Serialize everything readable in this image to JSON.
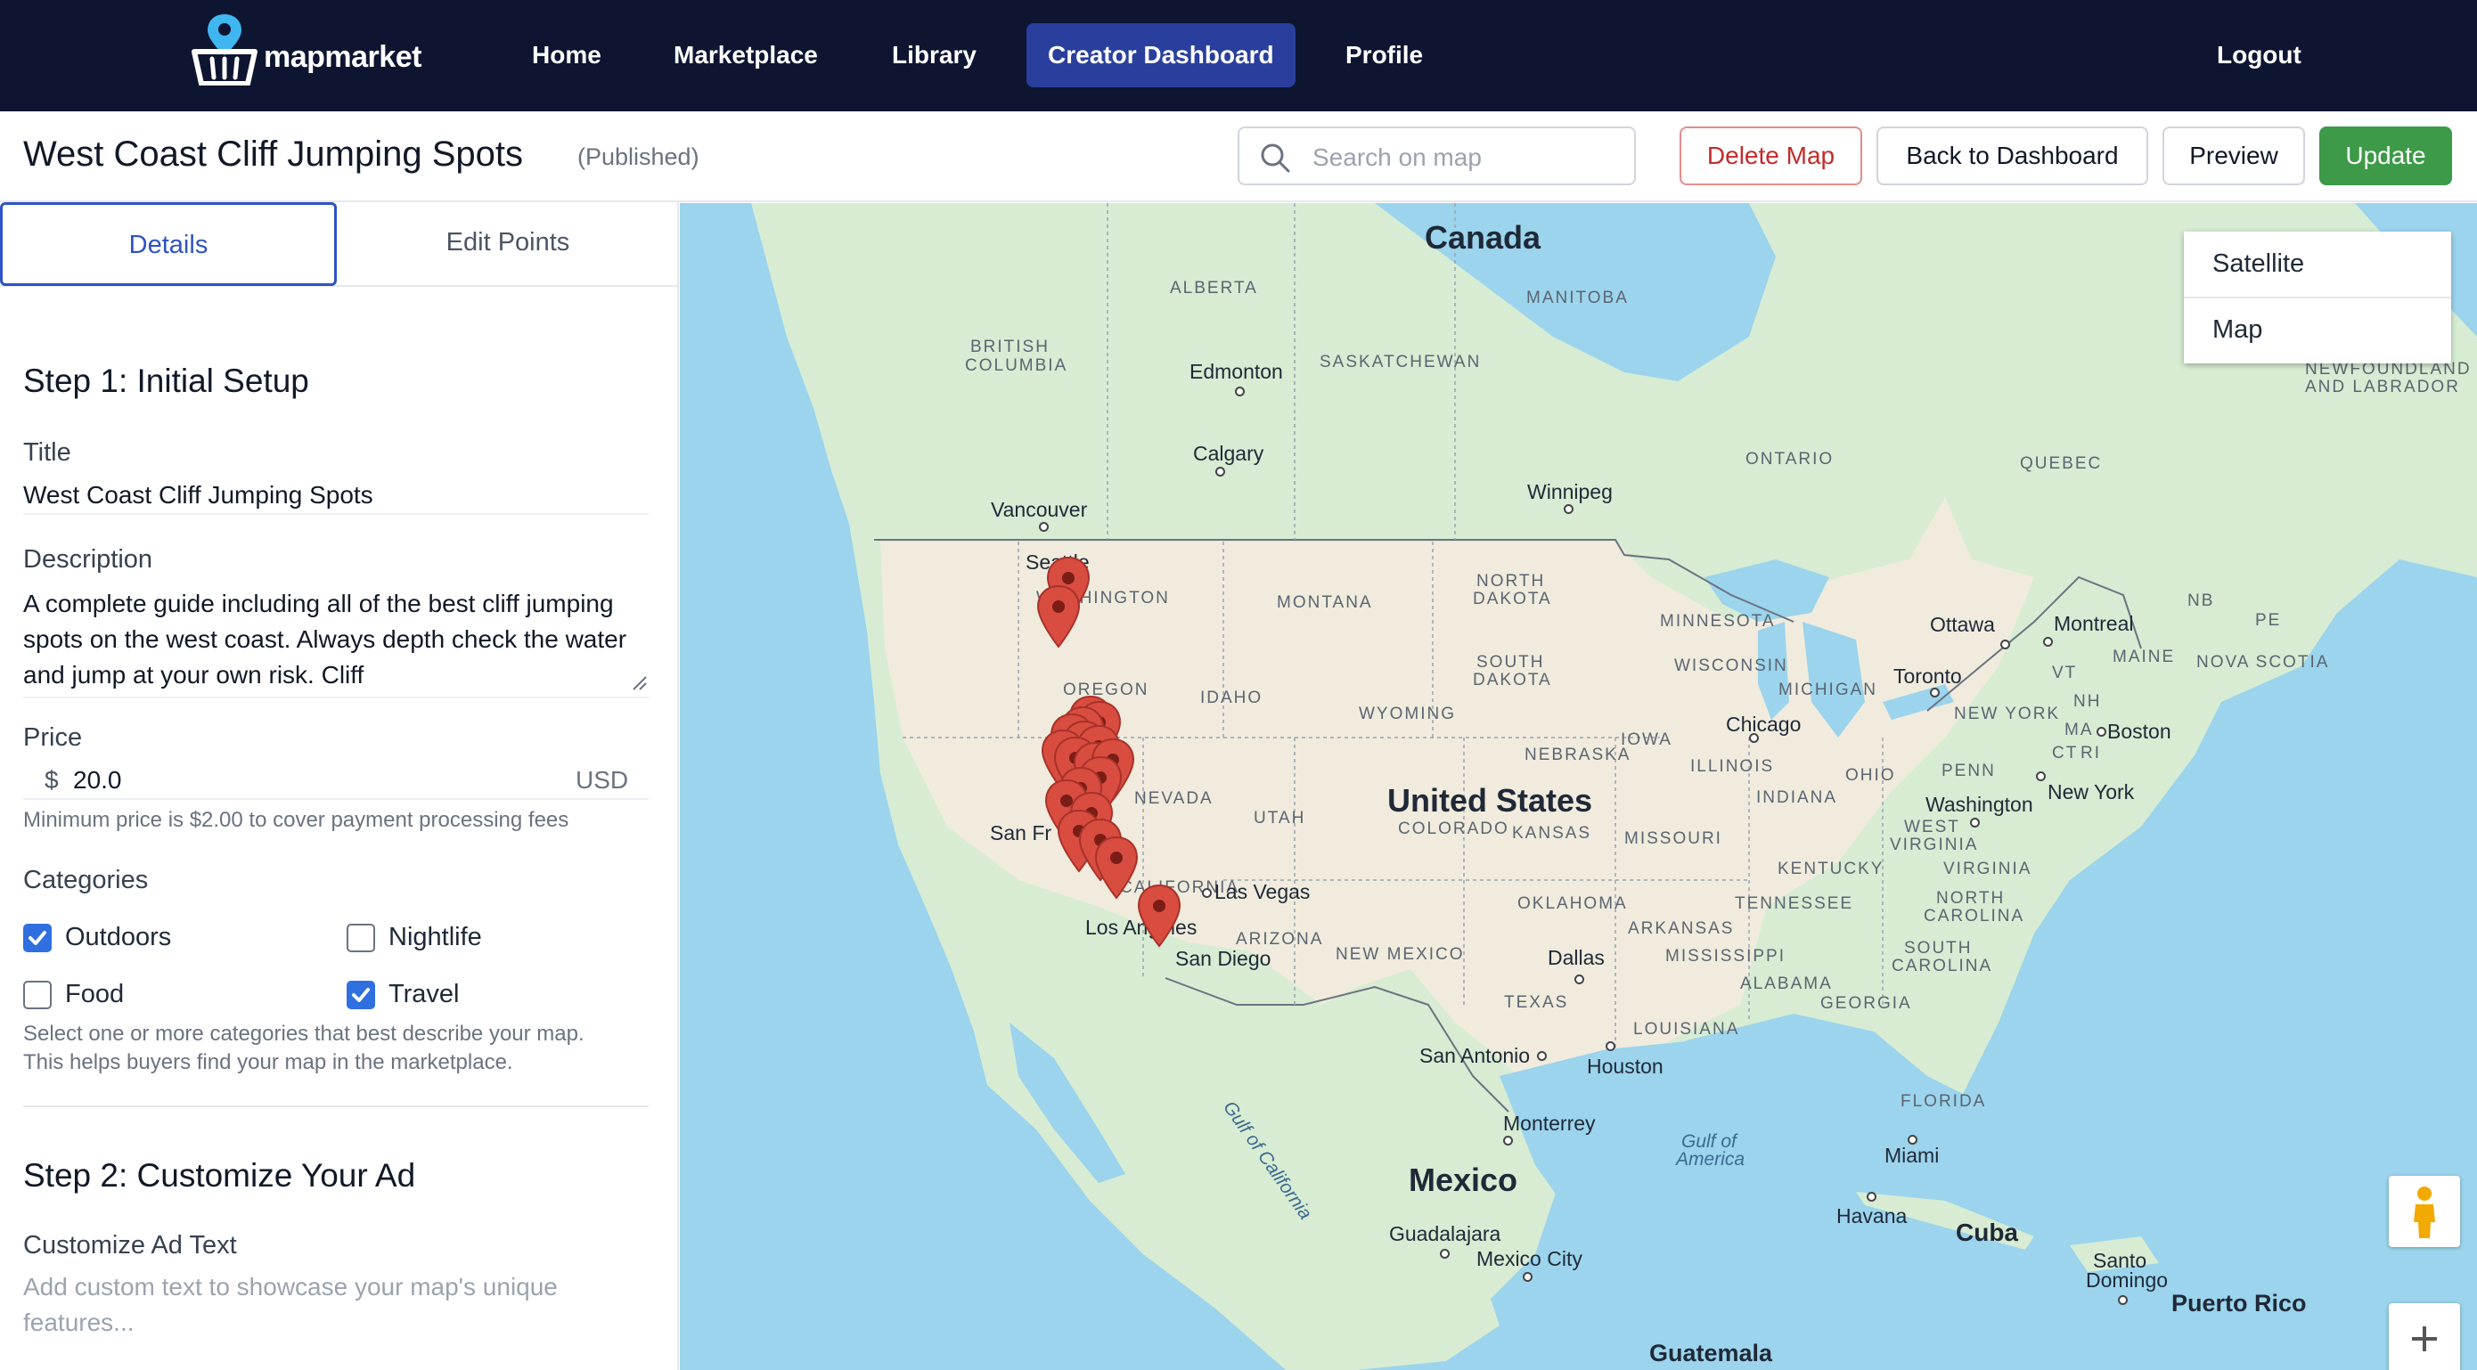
{
  "brand": {
    "name": "mapmarket"
  },
  "nav": {
    "items": [
      {
        "label": "Home"
      },
      {
        "label": "Marketplace"
      },
      {
        "label": "Library"
      },
      {
        "label": "Creator Dashboard",
        "active": true
      },
      {
        "label": "Profile"
      }
    ],
    "logout": "Logout"
  },
  "toolbar": {
    "title": "West Coast Cliff Jumping Spots",
    "status": "(Published)",
    "search_placeholder": "Search on map",
    "delete_label": "Delete Map",
    "back_label": "Back to Dashboard",
    "preview_label": "Preview",
    "update_label": "Update"
  },
  "sidebar": {
    "tabs": [
      {
        "label": "Details",
        "active": true
      },
      {
        "label": "Edit Points"
      }
    ],
    "step1_title": "Step 1: Initial Setup",
    "title_label": "Title",
    "title_value": "West Coast Cliff Jumping Spots",
    "description_label": "Description",
    "description_value": "A complete guide including all of the best cliff jumping spots on the west coast. Always depth check the water and jump at your own risk. Cliff",
    "price_label": "Price",
    "price_currency_symbol": "$",
    "price_value": "20.0",
    "price_currency": "USD",
    "price_help": "Minimum price is $2.00 to cover payment processing fees",
    "categories_label": "Categories",
    "categories": [
      {
        "label": "Outdoors",
        "checked": true
      },
      {
        "label": "Nightlife",
        "checked": false
      },
      {
        "label": "Food",
        "checked": false
      },
      {
        "label": "Travel",
        "checked": true
      }
    ],
    "categories_help_1": "Select one or more categories that best describe your map.",
    "categories_help_2": "This helps buyers find your map in the marketplace.",
    "step2_title": "Step 2: Customize Your Ad",
    "ad_text_label": "Customize Ad Text",
    "ad_text_placeholder": "Add custom text to showcase your map's unique features..."
  },
  "map": {
    "map_type_options": [
      "Satellite",
      "Map"
    ],
    "countries": {
      "canada": "Canada",
      "us": "United States",
      "mexico": "Mexico",
      "cuba": "Cuba",
      "puerto_rico": "Puerto Rico",
      "guatemala": "Guatemala"
    },
    "regions": {
      "alberta": "ALBERTA",
      "manitoba": "MANITOBA",
      "bc1": "BRITISH",
      "bc2": "COLUMBIA",
      "saskatchewan": "SASKATCHEWAN",
      "newfoundland1": "NEWFOUNDLAND",
      "newfoundland2": "AND LABRADOR",
      "ontario": "ONTARIO",
      "quebec": "QUEBEC",
      "washington": "WASHINGTON",
      "montana": "MONTANA",
      "north_dakota1": "NORTH",
      "north_dakota2": "DAKOTA",
      "south_dakota1": "SOUTH",
      "south_dakota2": "DAKOTA",
      "minnesota": "MINNESOTA",
      "wisconsin": "WISCONSIN",
      "michigan": "MICHIGAN",
      "oregon": "OREGON",
      "idaho": "IDAHO",
      "wyoming": "WYOMING",
      "nebraska": "NEBRASKA",
      "iowa": "IOWA",
      "illinois": "ILLINOIS",
      "indiana": "INDIANA",
      "ohio": "OHIO",
      "penn": "PENN",
      "nevada": "NEVADA",
      "utah": "UTAH",
      "colorado": "COLORADO",
      "kansas": "KANSAS",
      "missouri": "MISSOURI",
      "west_virginia1": "WEST",
      "west_virginia2": "VIRGINIA",
      "virginia": "VIRGINIA",
      "kentucky": "KENTUCKY",
      "california": "CALIFORNIA",
      "arizona": "ARIZONA",
      "new_mexico": "NEW MEXICO",
      "oklahoma": "OKLAHOMA",
      "arkansas": "ARKANSAS",
      "tennessee": "TENNESSEE",
      "north_carolina1": "NORTH",
      "north_carolina2": "CAROLINA",
      "south_carolina1": "SOUTH",
      "south_carolina2": "CAROLINA",
      "mississippi": "MISSISSIPPI",
      "alabama": "ALABAMA",
      "georgia": "GEORGIA",
      "texas": "TEXAS",
      "louisiana": "LOUISIANA",
      "florida": "FLORIDA",
      "new_york": "NEW YORK",
      "maine": "MAINE",
      "nb": "NB",
      "pe": "PE",
      "nova_scotia": "NOVA SCOTIA",
      "vt": "VT",
      "nh": "NH",
      "ma": "MA",
      "ct": "CT",
      "ri": "RI"
    },
    "cities": {
      "edmonton": "Edmonton",
      "calgary": "Calgary",
      "vancouver": "Vancouver",
      "winnipeg": "Winnipeg",
      "seattle": "Seattle",
      "ottawa": "Ottawa",
      "montreal": "Montreal",
      "toronto": "Toronto",
      "boston": "Boston",
      "chicago": "Chicago",
      "new_york": "New York",
      "washington": "Washington",
      "san_francisco": "San Fr",
      "las_vegas": "Las Vegas",
      "los_angeles": "Los Angeles",
      "san_diego": "San Diego",
      "dallas": "Dallas",
      "san_antonio": "San Antonio",
      "houston": "Houston",
      "monterrey": "Monterrey",
      "guadalajara": "Guadalajara",
      "mexico_city": "Mexico City",
      "miami": "Miami",
      "havana": "Havana",
      "santo_domingo1": "Santo",
      "santo_domingo2": "Domingo"
    },
    "water": {
      "gulf_california": "Gulf of California",
      "gulf_america1": "Gulf of",
      "gulf_america2": "America"
    }
  },
  "colors": {
    "navy": "#0d1530",
    "accent": "#2a3f9d",
    "success": "#3d9a48",
    "danger": "#c42b2b",
    "marker": "#d94c40"
  }
}
